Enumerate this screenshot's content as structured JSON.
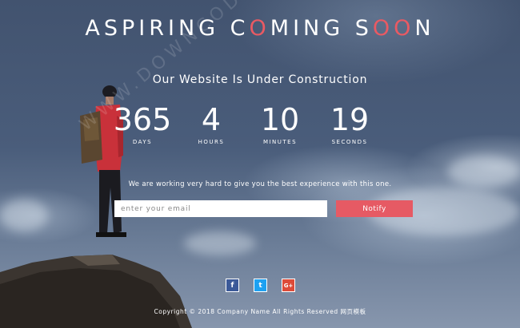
{
  "page": {
    "title_parts": [
      "ASPIRING C",
      "O",
      "MING S",
      "O",
      "O",
      "N"
    ],
    "subtitle": "Our Website Is Under Construction",
    "countdown": [
      {
        "value": "365",
        "label": "DAYS"
      },
      {
        "value": "4",
        "label": "HOURS"
      },
      {
        "value": "10",
        "label": "MINUTES"
      },
      {
        "value": "19",
        "label": "SECONDS"
      }
    ],
    "message": "We are working very hard to give you the best experience with this one.",
    "email_placeholder": "enter your email",
    "notify_label": "Notify",
    "social": {
      "facebook": "f",
      "twitter": "t",
      "googleplus": "G+"
    },
    "footer": "Copyright © 2018 Company Name All Rights Reserved 网页模板",
    "watermark": "WWW.DOWNCODE.COM"
  },
  "colors": {
    "accent": "#e95a63",
    "button": "#e65a64",
    "facebook": "#3b5998",
    "twitter": "#1da1f2",
    "googleplus": "#dd4b39"
  }
}
